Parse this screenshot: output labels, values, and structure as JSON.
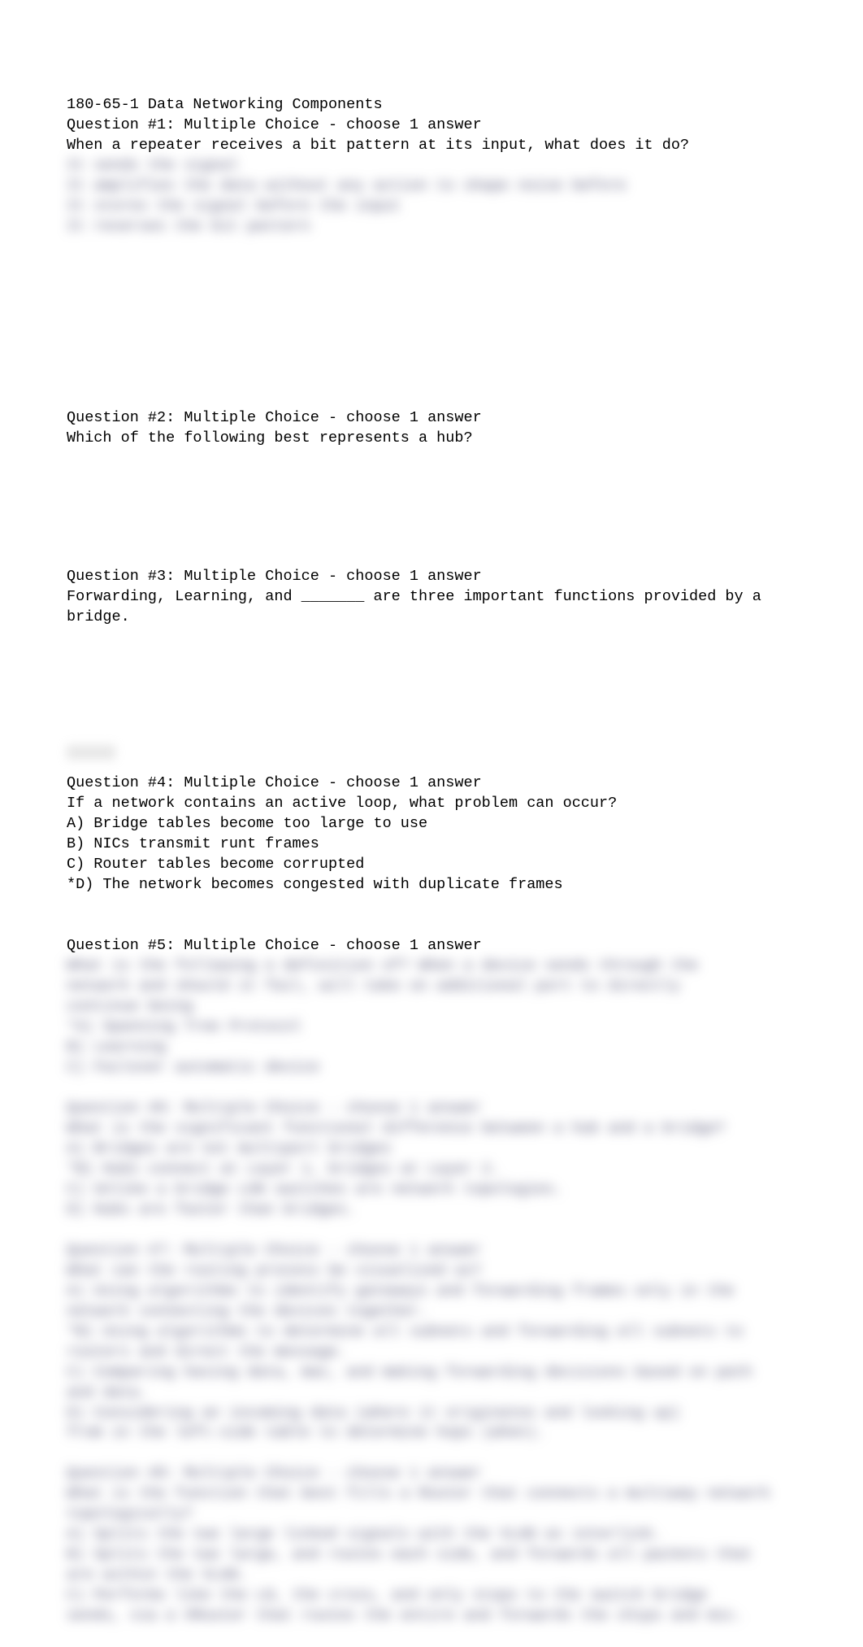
{
  "header": "180-65-1 Data Networking Components",
  "q1": {
    "title": "Question #1: Multiple Choice - choose 1 answer",
    "text": "When a repeater receives a bit pattern at its input, what does it do?",
    "blurred": "It sends the signal\nIt amplifies the data without any action to shape noise before\nIt stores the signal before the input\nIt reverses the bit pattern"
  },
  "q2": {
    "title": "Question #2: Multiple Choice - choose 1 answer",
    "text": "Which of the following best represents a hub?"
  },
  "q3": {
    "title": "Question #3: Multiple Choice - choose 1 answer",
    "text": "Forwarding, Learning, and _______ are three important functions provided by a bridge."
  },
  "q4": {
    "title": "Question #4: Multiple Choice - choose 1 answer",
    "text": "If a network contains an active loop, what problem can occur?",
    "a": "A) Bridge tables become too large to use",
    "b": "B) NICs transmit runt frames",
    "c": "C) Router tables become corrupted",
    "d": "*D) The network becomes congested with duplicate frames"
  },
  "q5": {
    "title": "Question #5: Multiple Choice - choose 1 answer",
    "blurred": "What is the following a definition of? When a device sends through the\nnetwork and should it fail, will take on additional port to directly\ncontinue being\n*A) Spanning Tree Protocol\nB) Learning\nC) Failover automatic device\n\nQuestion #6: Multiple Choice - choose 1 answer\nWhat is the significant functional difference between a hub and a bridge?\nA) Bridges are not multiport bridges\n*B) Hubs connect at Layer 1, bridges at Layer 2.\nC) Unlike a bridge LAN switches are network topologies.\nD) Hubs are faster than bridges.\n\nQuestion #7: Multiple Choice - choose 1 answer\nWhat can the routing process be visualized as?\nA) Using algorithms to identify gateways and forwarding frames only in the\nnetwork connecting the devices together.\n*B) Using algorithms to determine all subnets and forwarding all subnets to\nrouters and direct the message.\nC) Comparing having data, mac, and making forwarding decisions based on path\nand data.\nD) Considering an incoming data (where it originates and looking up)\nfrom in the left-side table to determine hops (when).\n\nQuestion #8: Multiple Choice - choose 1 answer\nWhat is the function that best fills a Router that connects a multiway network\ntopologically?\nA) Splits the two large linked signals with the VLAN as interlink.\nB) Splits the two large, and routes each side, and forwards all packets that\nare within the VLAN.\nC) Performs like the L0, the cross, and only stops to the switch bridge\nsends, via a VRouter that routes the entire and forwards the chips and mic."
  }
}
